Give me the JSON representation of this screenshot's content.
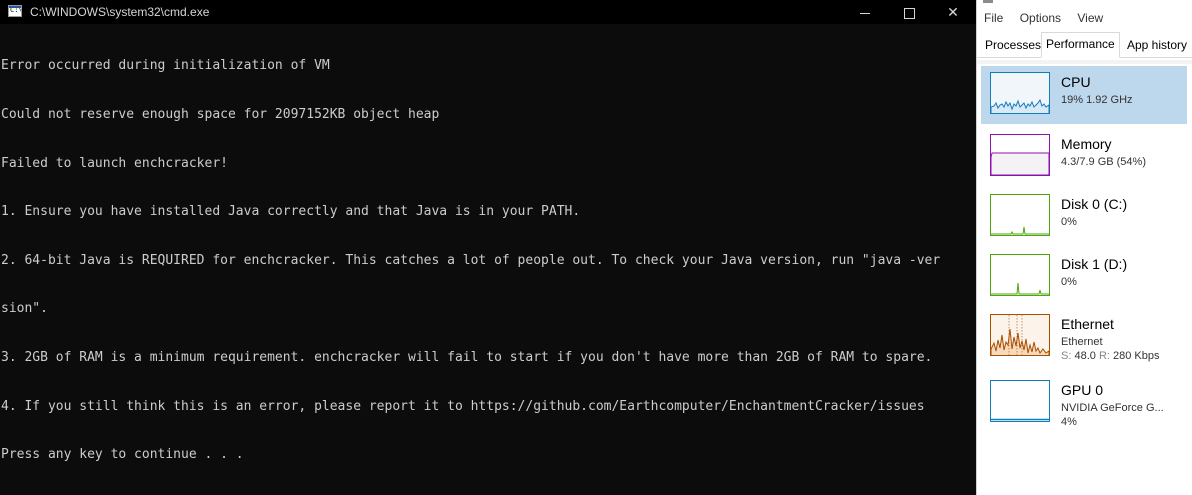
{
  "cmd": {
    "title": "C:\\WINDOWS\\system32\\cmd.exe",
    "icon_text": "C:\\",
    "lines": [
      "Error occurred during initialization of VM",
      "Could not reserve enough space for 2097152KB object heap",
      "Failed to launch enchcracker!",
      "1. Ensure you have installed Java correctly and that Java is in your PATH.",
      "2. 64-bit Java is REQUIRED for enchcracker. This catches a lot of people out. To check your Java version, run \"java -ver",
      "sion\".",
      "3. 2GB of RAM is a minimum requirement. enchcracker will fail to start if you don't have more than 2GB of RAM to spare.",
      "4. If you still think this is an error, please report it to https://github.com/Earthcomputer/EnchantmentCracker/issues",
      "Press any key to continue . . ."
    ],
    "buttons": {
      "close": "✕"
    }
  },
  "taskmgr": {
    "menu": [
      "File",
      "Options",
      "View"
    ],
    "tabs": [
      "Processes",
      "Performance",
      "App history"
    ],
    "items": [
      {
        "name": "CPU",
        "sub1": "19% 1.92 GHz",
        "color": "#117dbb",
        "fill": "#f1f6fa"
      },
      {
        "name": "Memory",
        "sub1": "4.3/7.9 GB (54%)",
        "color": "#8b12ae",
        "fill": "#f4f2f4"
      },
      {
        "name": "Disk 0 (C:)",
        "sub1": "0%",
        "color": "#4da60c",
        "fill": "#ffffff"
      },
      {
        "name": "Disk 1 (D:)",
        "sub1": "0%",
        "color": "#4da60c",
        "fill": "#ffffff"
      },
      {
        "name": "Ethernet",
        "sub1": "Ethernet",
        "sub2_s": "S:",
        "sub2_sv": "48.0",
        "sub2_r": "R:",
        "sub2_rv": "280 Kbps",
        "color": "#a74f01",
        "fill": "#fcf3eb"
      },
      {
        "name": "GPU 0",
        "sub1": "NVIDIA GeForce G...",
        "sub2": "4%",
        "color": "#117dbb",
        "fill": "#ffffff"
      }
    ]
  }
}
